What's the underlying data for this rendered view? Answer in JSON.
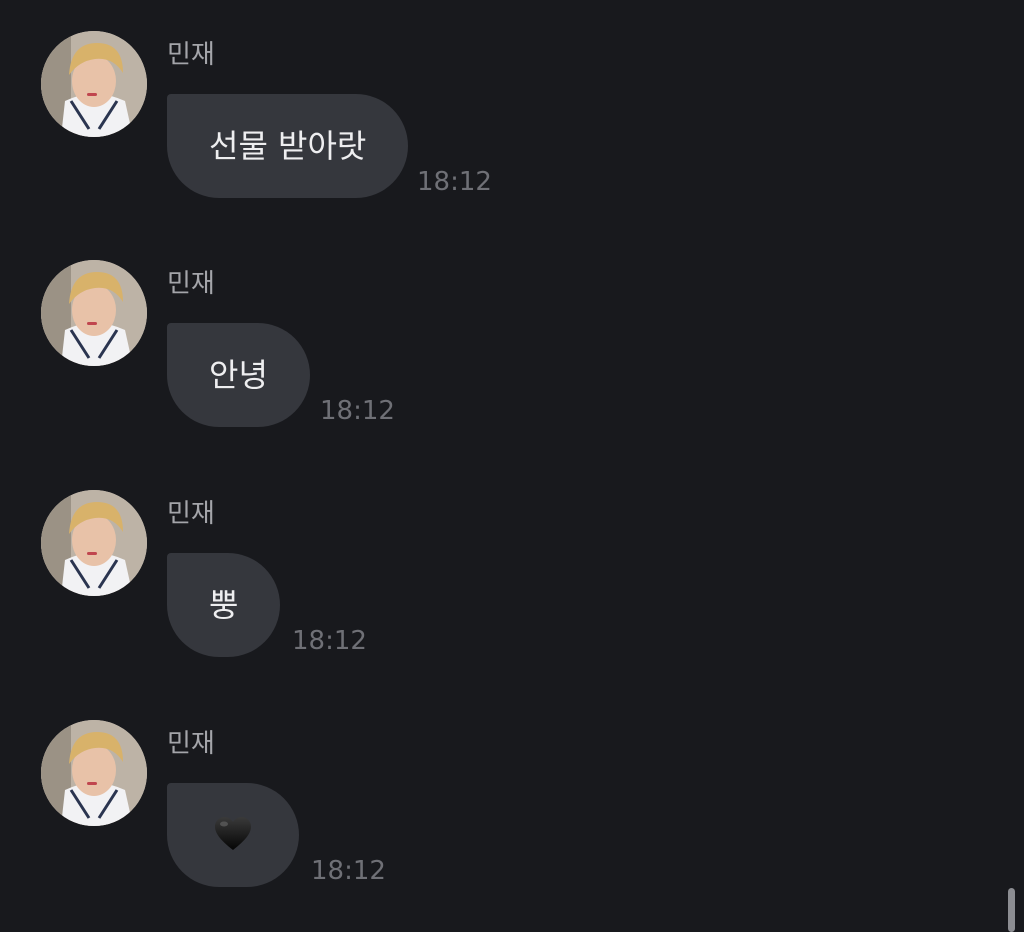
{
  "messages": [
    {
      "sender": "민재",
      "text": "선물 받아랏",
      "time": "18:12"
    },
    {
      "sender": "민재",
      "text": "안녕",
      "time": "18:12"
    },
    {
      "sender": "민재",
      "text": "뿡",
      "time": "18:12"
    },
    {
      "sender": "민재",
      "text": "🖤",
      "time": "18:12",
      "icon": "black-heart-icon"
    }
  ],
  "colors": {
    "background": "#18191d",
    "bubble": "#35373d",
    "bubble_text": "#eeeef0",
    "sender_text": "#a4a5aa",
    "time_text": "#6f7076"
  }
}
